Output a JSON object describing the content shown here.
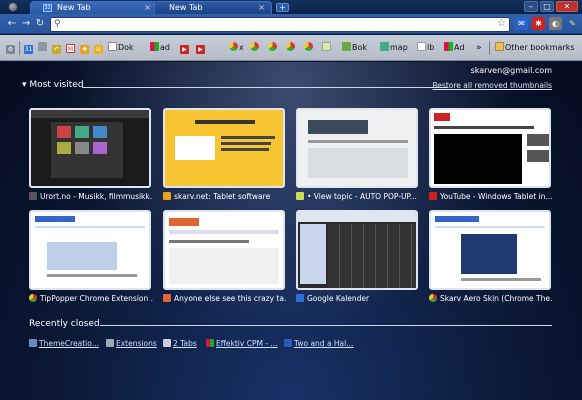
{
  "tabs": [
    {
      "label": "New Tab",
      "favicon": "31"
    },
    {
      "label": "New Tab",
      "favicon": ""
    }
  ],
  "window_controls": {
    "minimize": "–",
    "maximize": "□",
    "close": "✕"
  },
  "toolbar": {
    "omnibox_value": "",
    "back": "←",
    "forward": "→",
    "reload": "↻",
    "accent": "#3262ad"
  },
  "bookmarks": {
    "items": [
      {
        "label": "",
        "icon": "gear-icon",
        "color": "#7d8794"
      },
      {
        "label": "",
        "icon": "calendar-icon",
        "color": "#2c6fd8",
        "text": "31"
      },
      {
        "label": "",
        "icon": "folder-icon",
        "color": "#7d8794"
      },
      {
        "label": "",
        "icon": "undo-icon",
        "color": "#c8aa2a"
      },
      {
        "label": "",
        "icon": "gmail-icon",
        "color": "#c33"
      },
      {
        "label": "",
        "icon": "puzzle-icon",
        "color": "#e6a21c"
      },
      {
        "label": "",
        "icon": "u-icon",
        "color": "#eeae1f",
        "text": "U"
      },
      {
        "label": "Dok",
        "icon": "docs-icon",
        "color": "#d8d8d8"
      },
      {
        "label": "ad",
        "icon": "adwords-icon",
        "color": "#d14"
      },
      {
        "label": "",
        "icon": "youtube-icon",
        "color": "#c22"
      },
      {
        "label": "",
        "icon": "youtube-icon",
        "color": "#c22"
      },
      {
        "label": "x",
        "icon": "chrome-icon",
        "color": "#e3b"
      },
      {
        "label": "",
        "icon": "chrome-icon",
        "color": "#e3b"
      },
      {
        "label": "",
        "icon": "chrome-icon",
        "color": "#e3b"
      },
      {
        "label": "",
        "icon": "chrome-icon",
        "color": "#e3b"
      },
      {
        "label": "",
        "icon": "news-icon",
        "color": "#cfa"
      },
      {
        "label": "Bok",
        "icon": "books-icon",
        "color": "#6a4"
      },
      {
        "label": "map",
        "icon": "maps-icon",
        "color": "#4a8"
      },
      {
        "label": "lb",
        "icon": "doc-icon",
        "color": "#eee"
      },
      {
        "label": "Ad",
        "icon": "ads-icon",
        "color": "#d14"
      }
    ],
    "other_bookmarks": "Other bookmarks",
    "overflow": "»"
  },
  "ntp": {
    "user_email": "skarven@gmail.com",
    "most_visited_title": "Most visited",
    "restore_link": "Restore all removed thumbnails",
    "thumbnails": [
      {
        "title": "Urort.no - Musikk, filmmusikk...",
        "favicon_color": "#555",
        "theme": "dark-desktop"
      },
      {
        "title": "skarv.net: Tablet software",
        "favicon_color": "#e6a21c",
        "theme": "yellow"
      },
      {
        "title": "• View topic - AUTO POP-UP...",
        "favicon_color": "#cd5",
        "theme": "forum"
      },
      {
        "title": "YouTube - Windows Tablet in...",
        "favicon_color": "#c22",
        "theme": "youtube"
      },
      {
        "title": "TipPopper Chrome Extension ...",
        "favicon_color": "#e3b",
        "theme": "google-ext"
      },
      {
        "title": "Anyone else see this crazy ta...",
        "favicon_color": "#d63",
        "theme": "review"
      },
      {
        "title": "Google Kalender",
        "favicon_color": "#2c6fd8",
        "theme": "calendar"
      },
      {
        "title": "Skarv Aero Skin (Chrome The...",
        "favicon_color": "#e3b",
        "theme": "google-ext2"
      }
    ],
    "recently_closed_title": "Recently closed",
    "recently_closed": [
      {
        "label": "ThemeCreatio...",
        "icon": "window-icon"
      },
      {
        "label": "Extensions",
        "icon": "puzzle-icon"
      },
      {
        "label": "2 Tabs",
        "icon": "tabs-icon"
      },
      {
        "label": "Effektiv CPM - ...",
        "icon": "adwords-icon"
      },
      {
        "label": "Two and a Hal...",
        "icon": "tv-icon"
      }
    ]
  }
}
